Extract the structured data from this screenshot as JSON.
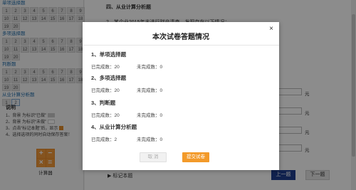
{
  "sidebar": {
    "sections": [
      {
        "title": "单项选择题",
        "cells": [
          "1",
          "2",
          "3",
          "4",
          "5",
          "6",
          "7",
          "8",
          "9",
          "10",
          "11",
          "12",
          "13",
          "14",
          "15",
          "16",
          "17",
          "18",
          "19",
          "20"
        ]
      },
      {
        "title": "多项选择题",
        "cells": [
          "1",
          "2",
          "3",
          "4",
          "5",
          "6",
          "7",
          "8",
          "9",
          "10",
          "11",
          "12",
          "13",
          "14",
          "15",
          "16",
          "17",
          "18",
          "19",
          "20"
        ]
      },
      {
        "title": "判断题",
        "cells": [
          "1",
          "2",
          "3",
          "4",
          "5",
          "6",
          "7",
          "8",
          "9",
          "10",
          "11",
          "12",
          "13",
          "14",
          "15",
          "16",
          "17",
          "18",
          "19",
          "20"
        ]
      },
      {
        "title": "从业计算分析题",
        "cells": [
          "1",
          "2"
        ]
      }
    ],
    "help": {
      "title": "说明",
      "lines": [
        "1、背景 为标识“已做”",
        "2、背景 为标识“未做”",
        "3、点击“标记本题”后，显示",
        "4、选择选项的同时自动保存答案！"
      ]
    },
    "calculator_label": "计算器"
  },
  "main": {
    "question_title": "四、从业计算分析题",
    "question_text": "2、某企业2015年末进行财产清查，发现存在以下情况：",
    "unit": "元",
    "mark_label": "标记本题",
    "prev_label": "上一题",
    "next_label": "下一题"
  },
  "modal": {
    "title": "本次试卷答题情况",
    "close": "×",
    "sections": [
      {
        "heading": "1、单项选择题",
        "done_label": "已完成数：",
        "done": "20",
        "todo_label": "未完成数：",
        "todo": "0"
      },
      {
        "heading": "2、多项选择题",
        "done_label": "已完成数：",
        "done": "20",
        "todo_label": "未完成数：",
        "todo": "0"
      },
      {
        "heading": "3、判断题",
        "done_label": "已完成数：",
        "done": "20",
        "todo_label": "未完成数：",
        "todo": "0"
      },
      {
        "heading": "4、从业计算分析题",
        "done_label": "已完成数：",
        "done": "2",
        "todo_label": "未完成数：",
        "todo": "0"
      }
    ],
    "cancel_label": "取 消",
    "submit_label": "提交试卷"
  },
  "colors": {
    "accent": "#f39a2a",
    "primary": "#1f3f8f",
    "overlay": "rgba(0,0,0,0.45)"
  }
}
